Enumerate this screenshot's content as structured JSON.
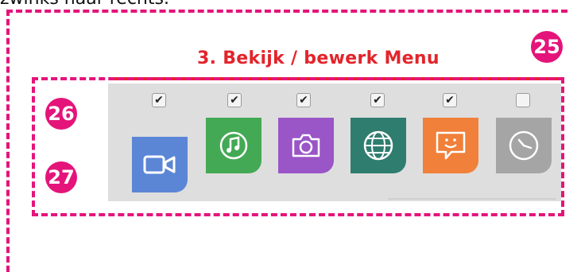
{
  "caption": "zwinks naar rechts.",
  "menu": {
    "title": "3. Bekijk / bewerk Menu"
  },
  "badges": {
    "b25": "25",
    "b26": "26",
    "b27": "27"
  },
  "items": [
    {
      "name": "video",
      "checked": true,
      "color": "#5b86d6",
      "icon": "video-camera-icon"
    },
    {
      "name": "music",
      "checked": true,
      "color": "#44a954",
      "icon": "music-note-icon"
    },
    {
      "name": "camera",
      "checked": true,
      "color": "#9a55c7",
      "icon": "camera-icon"
    },
    {
      "name": "web",
      "checked": true,
      "color": "#2f7d6f",
      "icon": "globe-icon"
    },
    {
      "name": "chat",
      "checked": true,
      "color": "#f0803a",
      "icon": "chat-smiley-icon"
    },
    {
      "name": "clock",
      "checked": false,
      "color": "#a5a5a5",
      "icon": "clock-icon"
    }
  ],
  "colors": {
    "annotation": "#e4147a",
    "title_red": "#e3242b"
  }
}
